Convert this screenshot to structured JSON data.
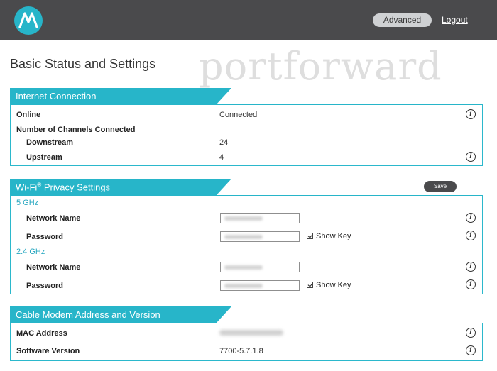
{
  "header": {
    "logo_icon": "motorola-batwing-icon",
    "advanced_label": "Advanced",
    "logout_label": "Logout",
    "bar_color": "#4a4a4c",
    "accent_color": "#27b5c9"
  },
  "page": {
    "title": "Basic Status and Settings",
    "watermark": "portforward"
  },
  "internet": {
    "title": "Internet Connection",
    "online_label": "Online",
    "online_value": "Connected",
    "channels_label": "Number of Channels Connected",
    "downstream_label": "Downstream",
    "downstream_value": "24",
    "upstream_label": "Upstream",
    "upstream_value": "4"
  },
  "wifi": {
    "title": "Wi-Fi",
    "title_sup": "®",
    "title_rest": " Privacy Settings",
    "save_label": "Save",
    "band_5": "5 GHz",
    "band_24": "2.4 GHz",
    "network_name_label": "Network Name",
    "password_label": "Password",
    "show_key_label": "Show Key"
  },
  "modem": {
    "title": "Cable Modem Address and Version",
    "mac_label": "MAC Address",
    "software_label": "Software Version",
    "software_value": "7700-5.7.1.8"
  }
}
